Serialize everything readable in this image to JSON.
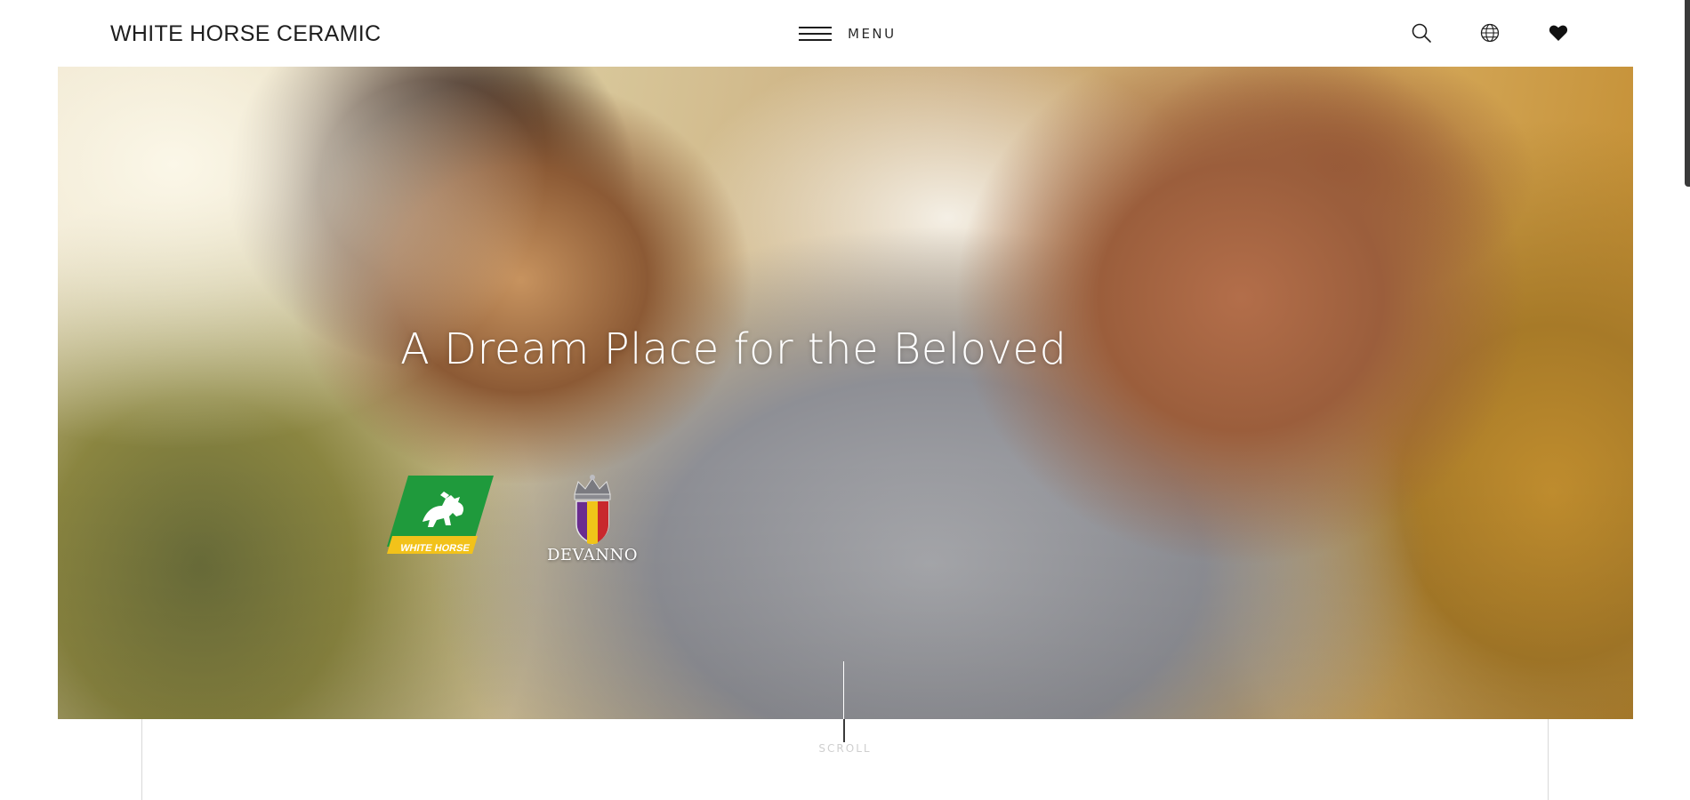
{
  "header": {
    "logo_text": "WHITE HORSE CERAMIC",
    "menu_label": "MENU",
    "icons": [
      "search-icon",
      "globe-icon",
      "heart-icon"
    ]
  },
  "hero": {
    "title": "A Dream Place for the Beloved",
    "brands": [
      {
        "name": "WHITE HORSE",
        "colors": {
          "green": "#1f9a3c",
          "yellow": "#f2c21a"
        }
      },
      {
        "name": "DEVANNO",
        "colors": {
          "purple": "#6a2c8f",
          "yellow": "#f0c419",
          "red": "#c8282d"
        }
      }
    ]
  },
  "scroll": {
    "label": "SCROLL"
  },
  "colors": {
    "text": "#1e1e1e",
    "background": "#ffffff",
    "divider": "#d8d8d8"
  }
}
